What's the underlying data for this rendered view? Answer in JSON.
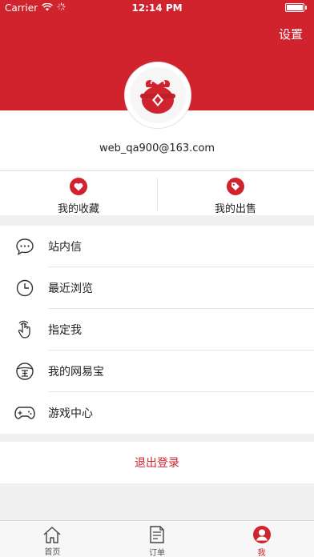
{
  "status_bar": {
    "carrier": "Carrier",
    "time": "12:14 PM"
  },
  "header": {
    "settings_label": "设置"
  },
  "profile": {
    "email": "web_qa900@163.com"
  },
  "quick_actions": [
    {
      "label": "我的收藏",
      "icon": "heart-icon"
    },
    {
      "label": "我的出售",
      "icon": "tag-icon"
    }
  ],
  "menu": [
    {
      "label": "站内信",
      "icon": "chat-bubble-icon"
    },
    {
      "label": "最近浏览",
      "icon": "clock-icon"
    },
    {
      "label": "指定我",
      "icon": "tap-hand-icon"
    },
    {
      "label": "我的网易宝",
      "icon": "wangyibao-icon"
    },
    {
      "label": "游戏中心",
      "icon": "gamepad-icon"
    }
  ],
  "logout_label": "退出登录",
  "tabbar": [
    {
      "label": "首页",
      "icon": "home-icon",
      "active": false
    },
    {
      "label": "订单",
      "icon": "order-icon",
      "active": false
    },
    {
      "label": "我",
      "icon": "profile-icon",
      "active": true
    }
  ],
  "colors": {
    "accent": "#d0232e",
    "background": "#f0f0f0"
  }
}
